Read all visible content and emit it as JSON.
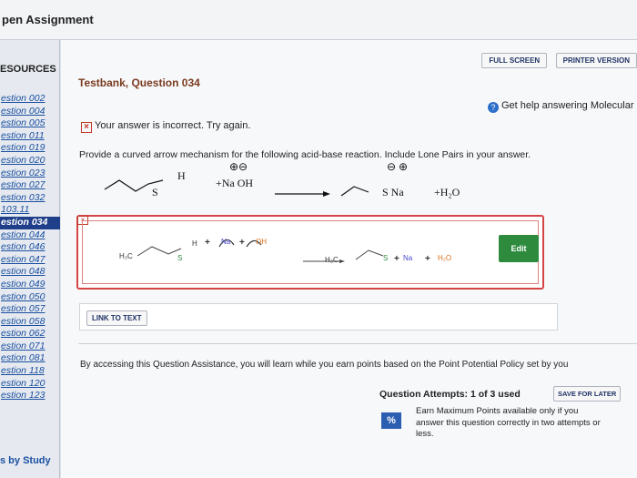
{
  "header": {
    "title": "pen Assignment"
  },
  "sidebar": {
    "heading": "ESOURCES",
    "items": [
      {
        "label": "estion 002"
      },
      {
        "label": "estion 004"
      },
      {
        "label": "estion 005"
      },
      {
        "label": "estion 011"
      },
      {
        "label": "estion 019"
      },
      {
        "label": "estion 020"
      },
      {
        "label": "estion 023"
      },
      {
        "label": "estion 027"
      },
      {
        "label": "estion 032"
      },
      {
        "label": "103.11"
      },
      {
        "label": "estion 034"
      },
      {
        "label": "estion 044"
      },
      {
        "label": "estion 046"
      },
      {
        "label": "estion 047"
      },
      {
        "label": "estion 048"
      },
      {
        "label": "estion 049"
      },
      {
        "label": "estion 050"
      },
      {
        "label": "estion 057"
      },
      {
        "label": "estion 058"
      },
      {
        "label": "estion 062"
      },
      {
        "label": "estion 071"
      },
      {
        "label": "estion 081"
      },
      {
        "label": "estion 118"
      },
      {
        "label": "estion 120"
      },
      {
        "label": "estion 123"
      }
    ],
    "active_index": 10,
    "footer": "s by Study"
  },
  "toolbar": {
    "full_screen": "FULL SCREEN",
    "printer_version": "PRINTER VERSION"
  },
  "question": {
    "title": "Testbank, Question 034",
    "help_text": "Get help answering Molecular",
    "incorrect_text": "Your answer is incorrect.  Try again.",
    "prompt": "Provide a curved arrow mechanism for the following acid-base reaction. Include Lone Pairs in your answer."
  },
  "reaction": {
    "h_label": "H",
    "s_label": "S",
    "charges_left": "⊕⊖",
    "reagent": "+Na OH",
    "charges_right": "⊖ ⊕",
    "product": "S  Na",
    "water": "+H₂O"
  },
  "answer": {
    "h3c": "H₃C",
    "s": "S",
    "h": "H",
    "plus": "+",
    "na": "Na",
    "oh": "OH",
    "h3c_right": "H₃C",
    "s_right": "S",
    "na_right": "Na",
    "water": "H₂O",
    "edit_label": "Edit"
  },
  "link_to_text": "LINK TO TEXT",
  "policy_text": "By accessing this Question Assistance, you will learn while you earn points based on the Point Potential Policy set by you",
  "attempts": {
    "label": "Question Attempts: 1 of 3 used",
    "save_label": "SAVE FOR LATER",
    "badge": "%",
    "earn_text": "Earn Maximum Points available only if you answer this question correctly in two attempts or less."
  }
}
